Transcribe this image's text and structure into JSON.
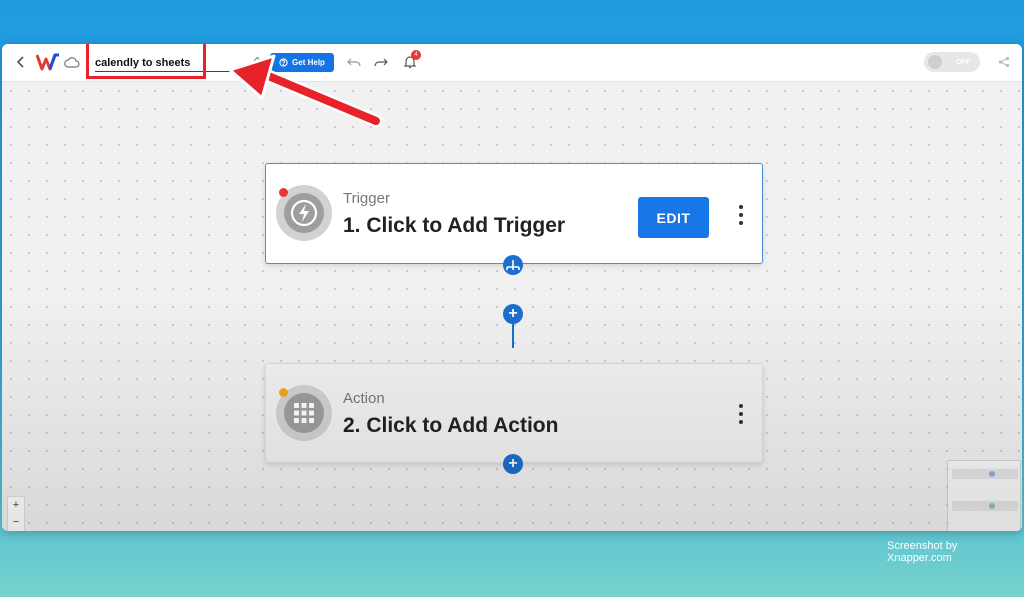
{
  "toolbar": {
    "workflow_name": "calendly to sheets",
    "help_label": "Get Help",
    "notification_count": "4",
    "toggle_label": "OFF"
  },
  "trigger": {
    "kind": "Trigger",
    "title": "1. Click to Add Trigger",
    "edit_label": "EDIT"
  },
  "action": {
    "kind": "Action",
    "title": "2. Click to Add Action"
  },
  "watermark": "Screenshot by Xnapper.com",
  "colors": {
    "accent": "#1473e6",
    "annotation_red": "#e8222a",
    "trigger_dot": "#e53935",
    "action_dot": "#f5a623"
  },
  "icons": [
    "back-icon",
    "logo-icon",
    "cloud-icon",
    "pencil-icon",
    "help-icon",
    "undo-icon",
    "redo-icon",
    "bell-icon",
    "share-icon",
    "lightning-icon",
    "grid-icon",
    "kebab-icon",
    "plus-icon"
  ]
}
